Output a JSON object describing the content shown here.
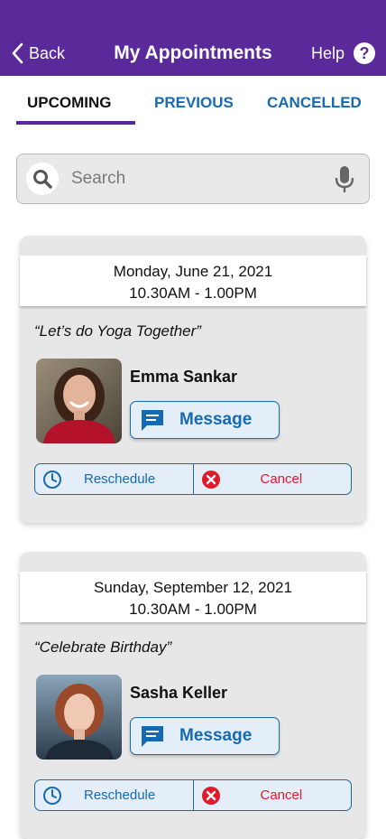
{
  "header": {
    "back_label": "Back",
    "title": "My Appointments",
    "help_label": "Help",
    "help_glyph": "?"
  },
  "tabs": [
    {
      "label": "UPCOMING",
      "active": true
    },
    {
      "label": "PREVIOUS",
      "active": false
    },
    {
      "label": "CANCELLED",
      "active": false
    }
  ],
  "search": {
    "placeholder": "Search",
    "value": ""
  },
  "appointments": [
    {
      "date": "Monday, June 21, 2021",
      "time": "10.30AM - 1.00PM",
      "event": "“Let’s do Yoga Together”",
      "person": "Emma Sankar",
      "message_label": "Message",
      "reschedule_label": "Reschedule",
      "cancel_label": "Cancel"
    },
    {
      "date": "Sunday, September 12, 2021",
      "time": "10.30AM - 1.00PM",
      "event": "“Celebrate Birthday”",
      "person": "Sasha Keller",
      "message_label": "Message",
      "reschedule_label": "Reschedule",
      "cancel_label": "Cancel"
    }
  ],
  "icons": {
    "back": "chevron-left-icon",
    "help": "question-circle-icon",
    "search": "magnifier-icon",
    "mic": "microphone-icon",
    "message": "chat-bubble-icon",
    "reschedule": "clock-icon",
    "cancel": "x-circle-icon"
  },
  "colors": {
    "header_bg": "#5a2a9a",
    "accent_blue": "#1769b0",
    "cancel_red": "#e0192b",
    "card_bg": "#e7e7e7",
    "button_bg": "#e3eef9"
  }
}
